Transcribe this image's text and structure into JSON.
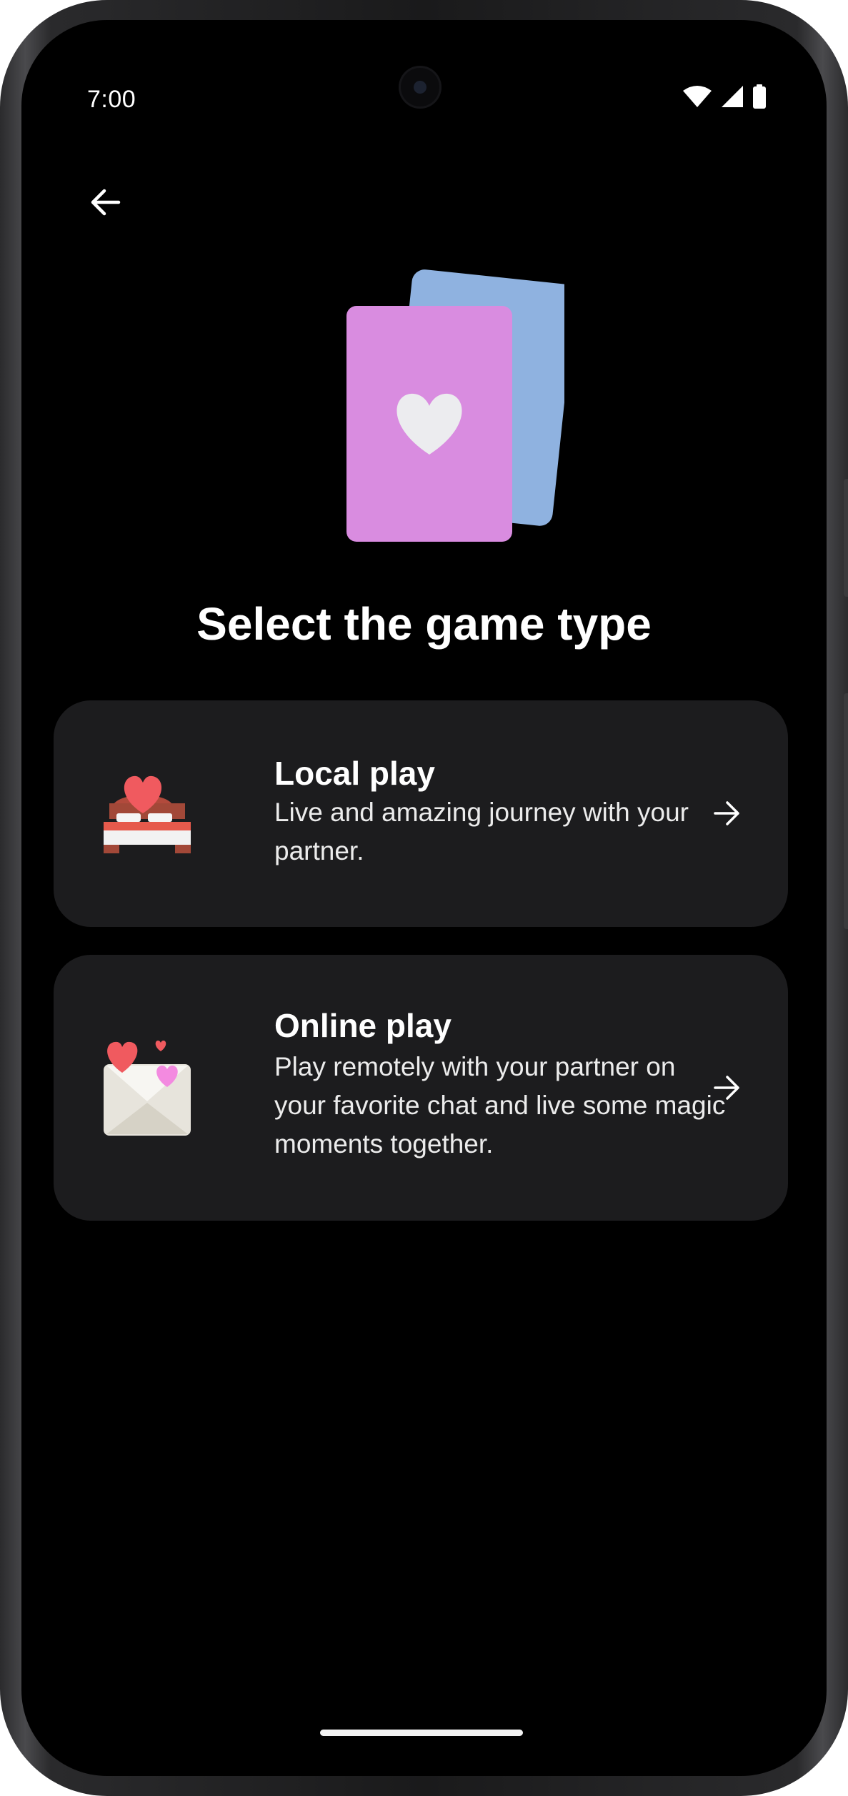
{
  "status_bar": {
    "time": "7:00",
    "icons": [
      "wifi-icon",
      "signal-icon",
      "battery-icon"
    ]
  },
  "nav": {
    "back_icon": "arrow-back-icon"
  },
  "hero": {
    "icon": "heart-cards-illustration"
  },
  "page": {
    "title": "Select the game type"
  },
  "options": [
    {
      "title": "Local play",
      "description": "Live and amazing journey with your partner.",
      "icon": "bed-heart-icon"
    },
    {
      "title": "Online play",
      "description": "Play remotely with your partner on your favorite chat and live some magic moments together.",
      "icon": "love-letter-icon"
    }
  ],
  "colors": {
    "background": "#000000",
    "card": "#1c1c1e",
    "card_front": "#d98ce0",
    "card_back": "#8fb2e0",
    "heart": "#ececef"
  }
}
